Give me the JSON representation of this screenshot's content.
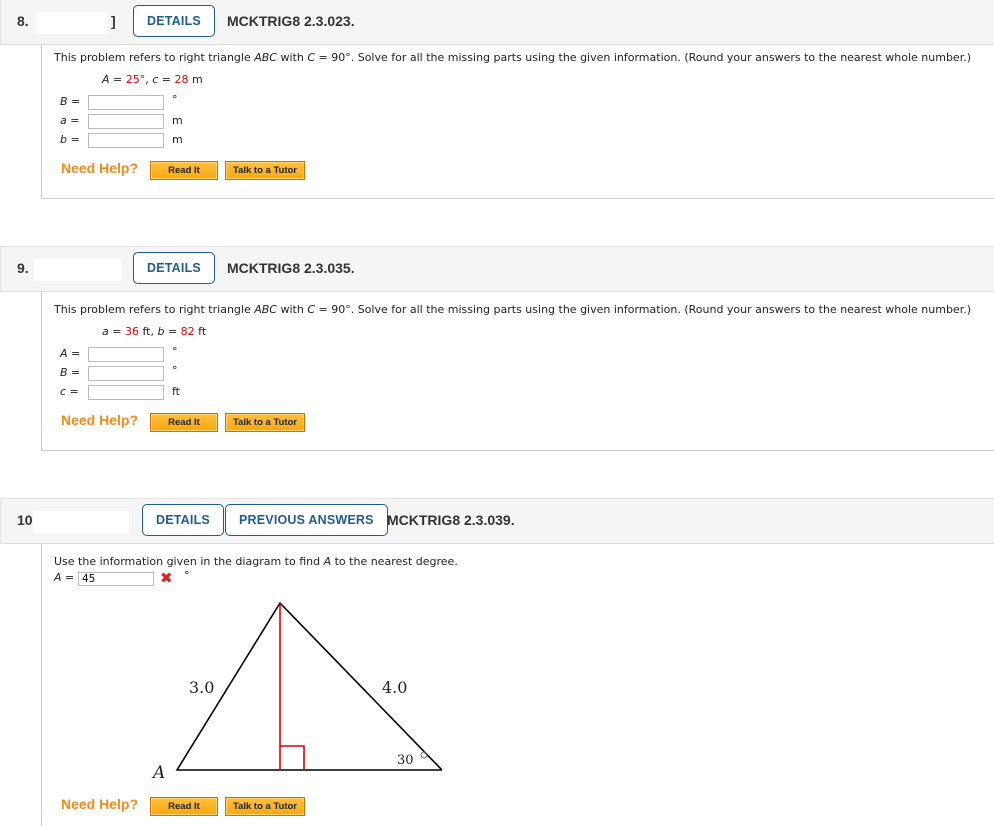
{
  "questions": [
    {
      "number": "8.",
      "points_partial": "]",
      "details_label": "DETAILS",
      "code": "MCKTRIG8 2.3.023.",
      "prompt_pre": "This problem refers to right triangle ",
      "prompt_triangle": "ABC",
      "prompt_mid": " with ",
      "prompt_c": "C",
      "prompt_post": " = 90°. Solve for all the missing parts using the given information. (Round your answers to the nearest whole number.)",
      "given": {
        "v1": "A",
        "val1": "25°",
        "u1": "",
        "v2": "c",
        "val2": "28",
        "u2": "m"
      },
      "fields": [
        {
          "label": "B",
          "value": "",
          "unit": "°"
        },
        {
          "label": "a",
          "value": "",
          "unit": "m"
        },
        {
          "label": "b",
          "value": "",
          "unit": "m"
        }
      ],
      "help_label": "Need Help?",
      "read_it": "Read It",
      "tutor": "Talk to a Tutor"
    },
    {
      "number": "9.",
      "details_label": "DETAILS",
      "code": "MCKTRIG8 2.3.035.",
      "prompt_pre": "This problem refers to right triangle ",
      "prompt_triangle": "ABC",
      "prompt_mid": " with ",
      "prompt_c": "C",
      "prompt_post": " = 90°. Solve for all the missing parts using the given information. (Round your answers to the nearest whole number.)",
      "given": {
        "v1": "a",
        "val1": "36",
        "u1": "ft",
        "v2": "b",
        "val2": "82",
        "u2": "ft"
      },
      "fields": [
        {
          "label": "A",
          "value": "",
          "unit": "°"
        },
        {
          "label": "B",
          "value": "",
          "unit": "°"
        },
        {
          "label": "c",
          "value": "",
          "unit": "ft"
        }
      ],
      "help_label": "Need Help?",
      "read_it": "Read It",
      "tutor": "Talk to a Tutor"
    },
    {
      "number": "10",
      "details_label": "DETAILS",
      "prev_answers_label": "PREVIOUS ANSWERS",
      "code": "MCKTRIG8 2.3.039.",
      "prompt_pre": "Use the information given in the diagram to find ",
      "prompt_var": "A",
      "prompt_post": " to the nearest degree.",
      "answer_label": "A",
      "answer_value": "45",
      "answer_status": "incorrect",
      "answer_unit": "°",
      "diagram": {
        "left_side": "3.0",
        "right_side": "4.0",
        "angle_label": "30",
        "vertex_label": "A",
        "altitude_color": "#e00000"
      },
      "help_label": "Need Help?",
      "read_it": "Read It",
      "tutor": "Talk to a Tutor"
    }
  ],
  "colors": {
    "accent": "#1f5c8f",
    "given_value": "#e00000",
    "help": "#f08a1c"
  }
}
